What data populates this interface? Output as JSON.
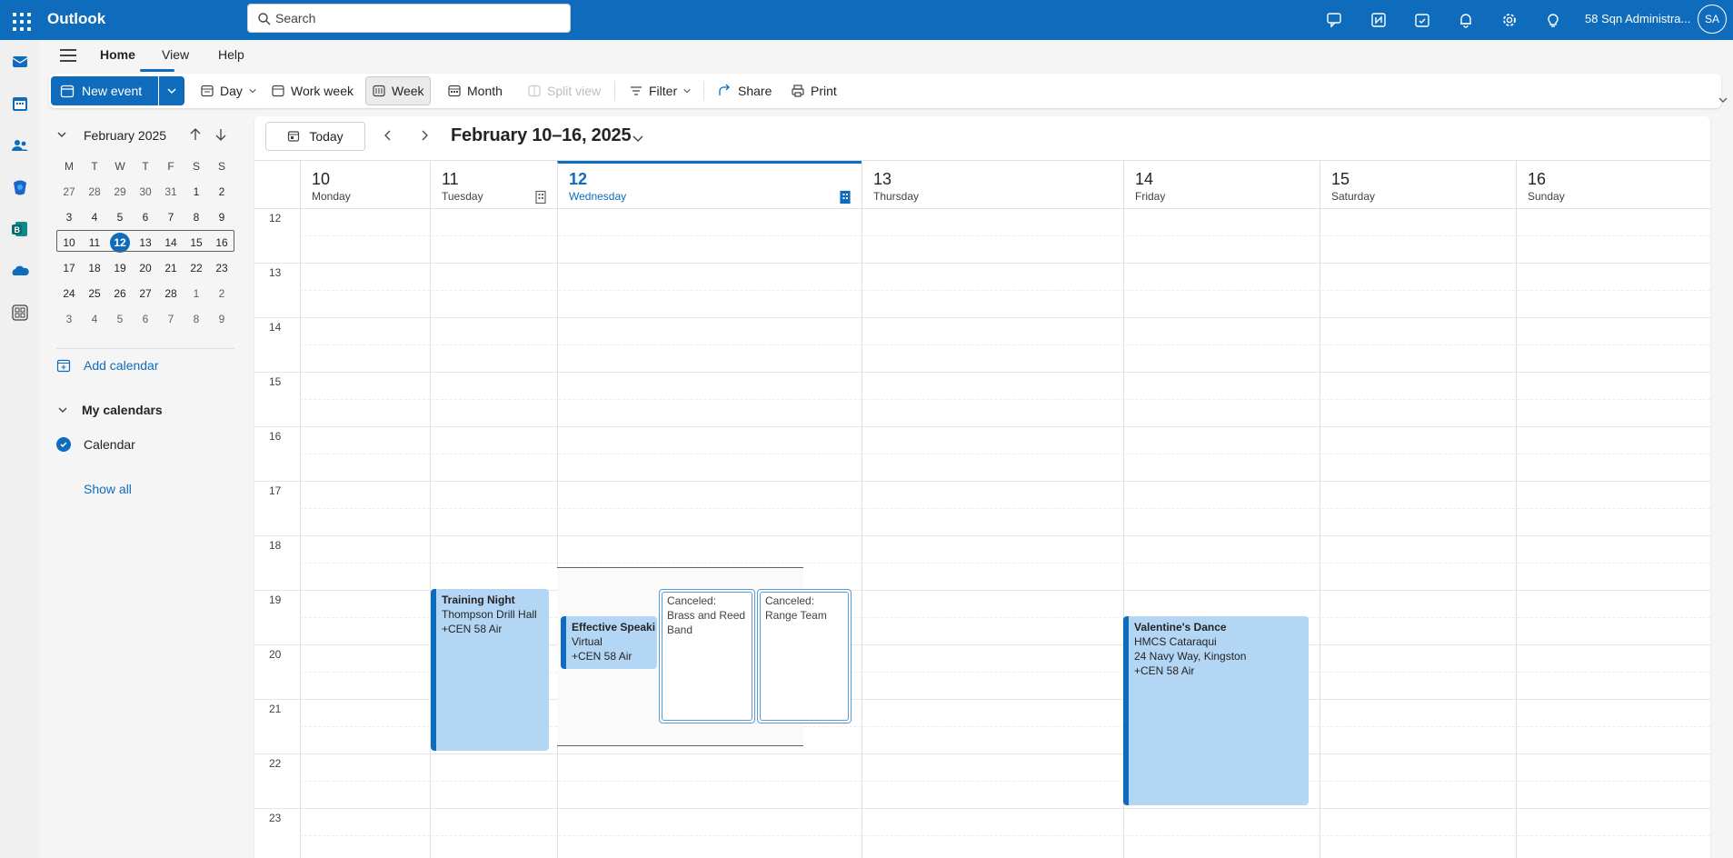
{
  "app": {
    "name": "Outlook"
  },
  "search": {
    "placeholder": "Search"
  },
  "account": {
    "name": "58 Sqn Administra...",
    "initials": "SA"
  },
  "tabs": [
    {
      "label": "Home"
    },
    {
      "label": "View"
    },
    {
      "label": "Help"
    }
  ],
  "ribbon": {
    "new_event": "New event",
    "day": "Day",
    "work_week": "Work week",
    "week": "Week",
    "month": "Month",
    "split_view": "Split view",
    "filter": "Filter",
    "share": "Share",
    "print": "Print"
  },
  "mini_calendar": {
    "title": "February 2025",
    "weekdays": [
      "M",
      "T",
      "W",
      "T",
      "F",
      "S",
      "S"
    ],
    "weeks": [
      [
        "27",
        "28",
        "29",
        "30",
        "31",
        "1",
        "2"
      ],
      [
        "3",
        "4",
        "5",
        "6",
        "7",
        "8",
        "9"
      ],
      [
        "10",
        "11",
        "12",
        "13",
        "14",
        "15",
        "16"
      ],
      [
        "17",
        "18",
        "19",
        "20",
        "21",
        "22",
        "23"
      ],
      [
        "24",
        "25",
        "26",
        "27",
        "28",
        "1",
        "2"
      ],
      [
        "3",
        "4",
        "5",
        "6",
        "7",
        "8",
        "9"
      ]
    ],
    "today": "12"
  },
  "left_panel": {
    "add_calendar": "Add calendar",
    "my_calendars": "My calendars",
    "calendar": "Calendar",
    "show_all": "Show all"
  },
  "toolbar": {
    "today": "Today",
    "range": "February 10–16, 2025"
  },
  "days": [
    {
      "num": "10",
      "name": "Monday"
    },
    {
      "num": "11",
      "name": "Tuesday"
    },
    {
      "num": "12",
      "name": "Wednesday"
    },
    {
      "num": "13",
      "name": "Thursday"
    },
    {
      "num": "14",
      "name": "Friday"
    },
    {
      "num": "15",
      "name": "Saturday"
    },
    {
      "num": "16",
      "name": "Sunday"
    }
  ],
  "hours": [
    "12",
    "13",
    "14",
    "15",
    "16",
    "17",
    "18",
    "19",
    "20",
    "21",
    "22",
    "23"
  ],
  "events": [
    {
      "title": "Training Night",
      "line1": "Thompson Drill Hall",
      "line2": "+CEN 58 Air",
      "line3": ""
    },
    {
      "title": "Effective Speaki",
      "line1": "Virtual",
      "line2": "+CEN 58 Air",
      "line3": ""
    },
    {
      "title": "Canceled: Brass and Reed Band"
    },
    {
      "title": "Canceled: Range Team"
    },
    {
      "title": "Valentine's Dance",
      "line1": "HMCS Cataraqui",
      "line2": "24 Navy Way, Kingston",
      "line3": "+CEN 58 Air"
    }
  ],
  "colors": {
    "brand": "#0f6cbd",
    "event_fill": "#b4d6f5"
  }
}
